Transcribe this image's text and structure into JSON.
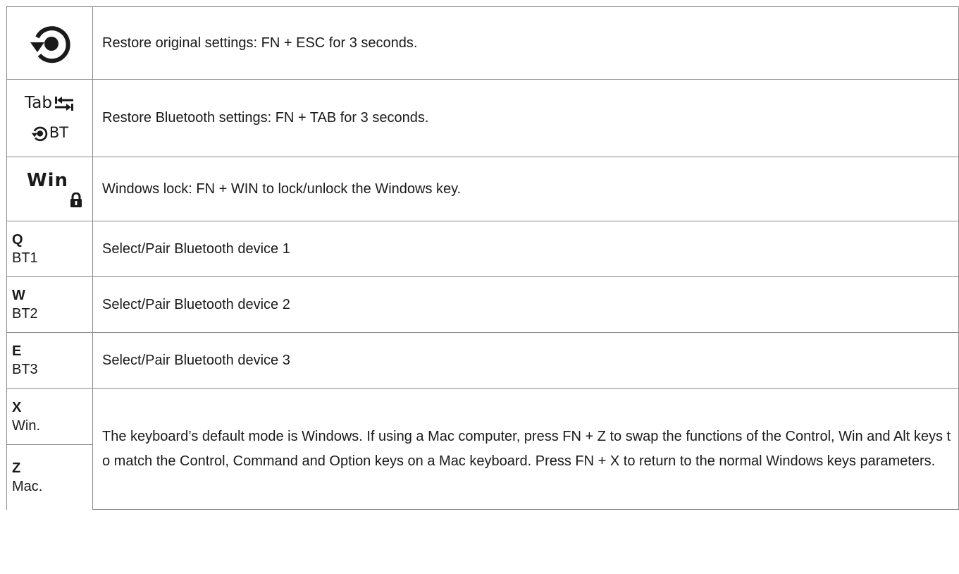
{
  "rows": [
    {
      "key_icon": "restore-icon",
      "description": "Restore original settings: FN + ESC for 3 seconds."
    },
    {
      "key_label": "Tab",
      "key_sub": "BT",
      "key_icon": "tab-arrows-icon",
      "description": "Restore Bluetooth settings: FN + TAB for 3 seconds."
    },
    {
      "key_label": "Win",
      "key_icon": "lock-icon",
      "description": "Windows lock: FN + WIN to lock/unlock the Windows key."
    },
    {
      "key_label": "Q",
      "key_sub": "BT1",
      "description": "Select/Pair Bluetooth device 1"
    },
    {
      "key_label": "W",
      "key_sub": "BT2",
      "description": "Select/Pair Bluetooth device 2"
    },
    {
      "key_label": "E",
      "key_sub": "BT3",
      "description": "Select/Pair Bluetooth device 3"
    },
    {
      "key_label": "X",
      "key_sub": "Win.",
      "description": "The keyboard’s default mode is Windows. If using a Mac computer, press FN + Z to swap the functions of the Control, Win and Alt keys to match the Control, Command and Option keys on a Mac keyboard. Press FN + X to return to the normal Windows keys parameters."
    },
    {
      "key_label": "Z",
      "key_sub": "Mac."
    }
  ],
  "colors": {
    "border": "#8c8c8c",
    "text": "#1a1a1a",
    "icon": "#1a1a1a"
  }
}
